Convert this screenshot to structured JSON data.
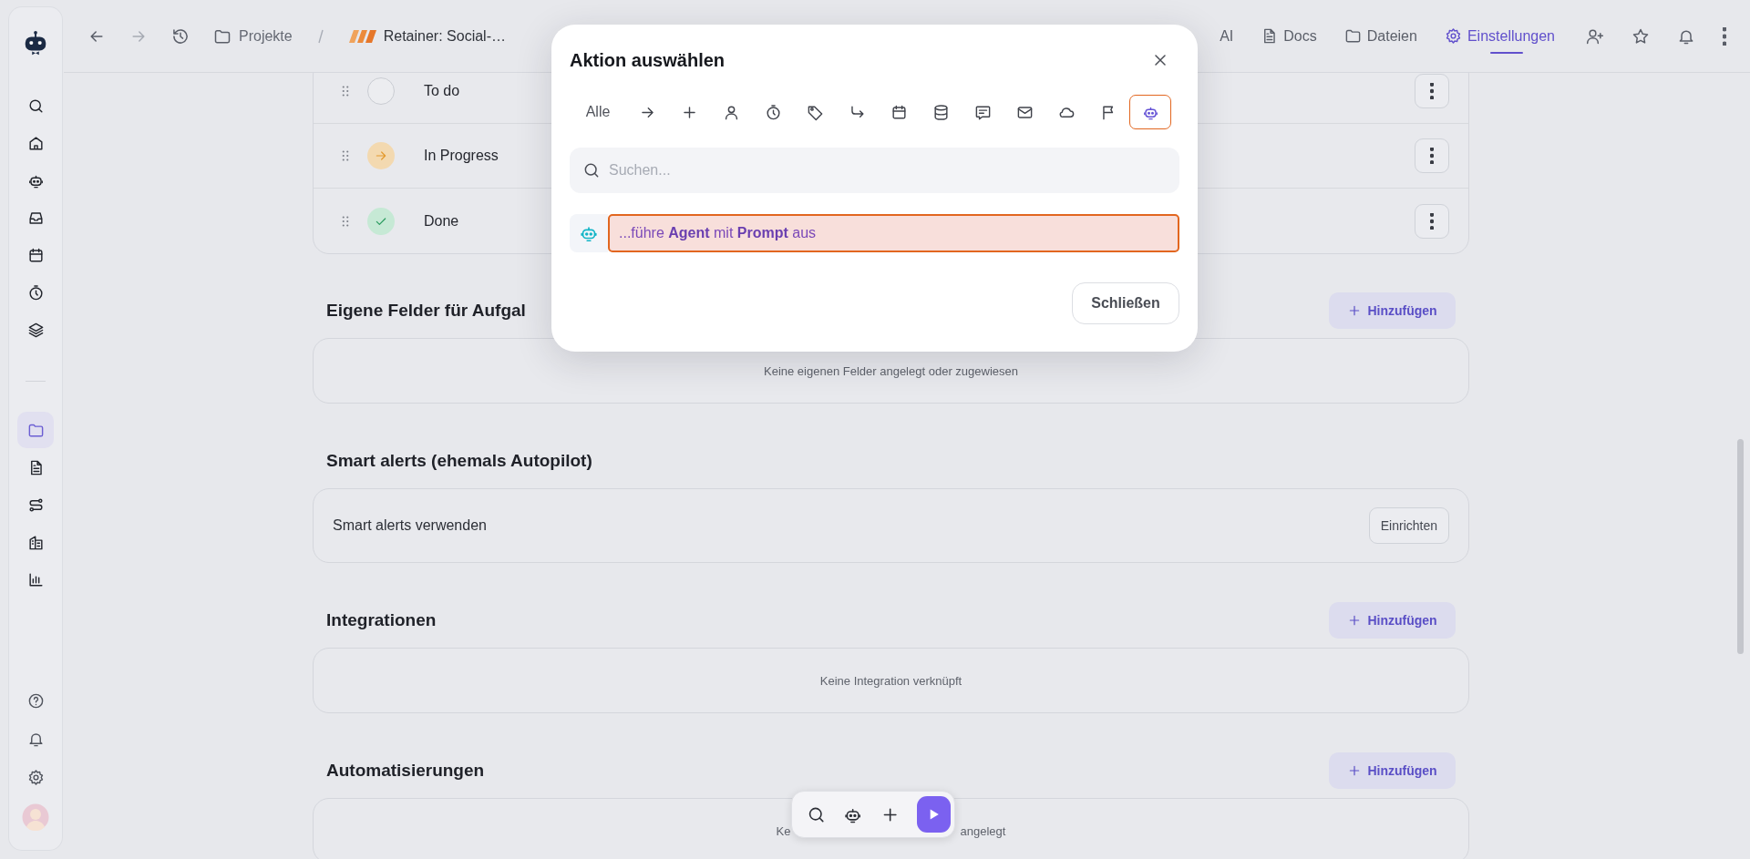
{
  "sidebar": {
    "main_items": [
      {
        "selected": false
      },
      {
        "selected": false
      },
      {
        "selected": false
      },
      {
        "selected": false
      },
      {
        "selected": false
      },
      {
        "selected": false
      },
      {
        "selected": false
      }
    ],
    "project_items": [
      {
        "selected": true
      },
      {
        "selected": false
      },
      {
        "selected": false
      },
      {
        "selected": false
      },
      {
        "selected": false
      }
    ]
  },
  "topbar": {
    "breadcrumb": [
      "Projekte",
      "Retainer: Social-…"
    ],
    "tabs": [
      {
        "label": "AI",
        "selected": false
      },
      {
        "label": "Docs",
        "selected": false
      },
      {
        "label": "Dateien",
        "selected": false
      },
      {
        "label": "Einstellungen",
        "selected": true
      }
    ]
  },
  "statuses": [
    {
      "name": "To do",
      "kind": "todo"
    },
    {
      "name": "In Progress",
      "kind": "progress"
    },
    {
      "name": "Done",
      "kind": "done"
    }
  ],
  "sections": [
    {
      "title": "Eigene Felder für Aufgal",
      "add_button": "Hinzufügen",
      "kind": "empty",
      "message": [
        "Keine eigenen Felder angelegt oder zugewiesen"
      ]
    },
    {
      "title": "Smart alerts (ehemals Autopilot)",
      "kind": "setting",
      "label": "Smart alerts verwenden",
      "button": "Einrichten"
    },
    {
      "title": "Integrationen",
      "add_button": "Hinzufügen",
      "kind": "empty",
      "message": [
        "Keine Integration verknüpft"
      ]
    },
    {
      "title": "Automatisierungen",
      "add_button": "Hinzufügen",
      "kind": "empty",
      "message": [
        "Ke",
        "angelegt"
      ]
    }
  ],
  "modal": {
    "title": "Aktion auswählen",
    "filter_all": {
      "label": "Alle",
      "selected": false
    },
    "filter_icons": [
      {
        "selected": false
      },
      {
        "selected": false
      },
      {
        "selected": false
      },
      {
        "selected": false
      },
      {
        "selected": false
      },
      {
        "selected": false
      },
      {
        "selected": false
      },
      {
        "selected": false
      },
      {
        "selected": false
      },
      {
        "selected": false
      },
      {
        "selected": false
      },
      {
        "selected": false
      },
      {
        "selected": true
      }
    ],
    "search": {
      "placeholder": "Suchen..."
    },
    "results": [
      {
        "text": "...führe **Agent** mit **Prompt** aus",
        "selected": true
      }
    ],
    "close_button": "Schließen"
  }
}
